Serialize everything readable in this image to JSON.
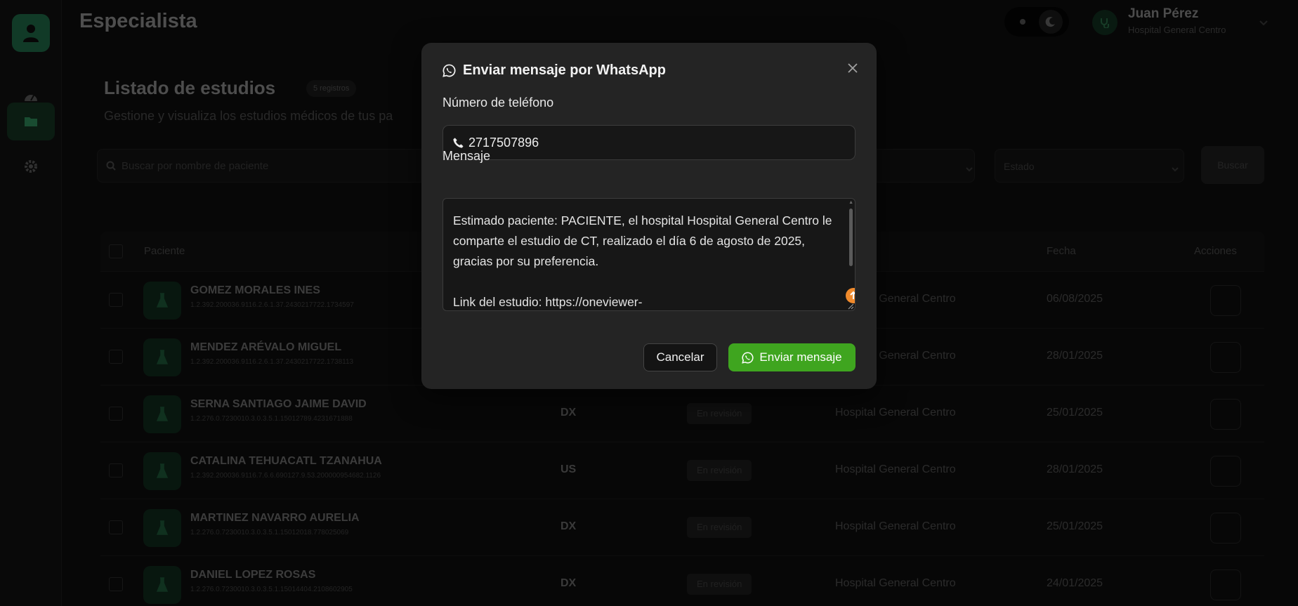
{
  "header": {
    "title": "Especialista",
    "user_name": "Juan Pérez",
    "user_hospital": "Hospital General Centro"
  },
  "sidebar": {
    "items": [
      {
        "icon": "dashboard-icon"
      },
      {
        "icon": "folder-icon",
        "active": true
      },
      {
        "icon": "gear-icon"
      }
    ]
  },
  "page": {
    "title": "Listado de estudios",
    "count_badge": "5 registros",
    "subtitle": "Gestione y visualiza los estudios médicos de tus pa",
    "search_placeholder": "Buscar por nombre de paciente",
    "estado_placeholder": "Estado",
    "buscar_label": "Buscar"
  },
  "table": {
    "headers": {
      "paciente": "Paciente",
      "fecha": "Fecha",
      "acciones": "Acciones"
    },
    "rows": [
      {
        "name": "GOMEZ MORALES INES",
        "uid": "1.2.392.200036.9116.2.6.1.37.2430217722.1734597",
        "modality": "",
        "status": "",
        "hospital": "Hospital General Centro",
        "date": "06/08/2025"
      },
      {
        "name": "MENDEZ ARÉVALO MIGUEL",
        "uid": "1.2.392.200036.9116.2.6.1.37.2430217722.1738113",
        "modality": "",
        "status": "",
        "hospital": "Hospital General Centro",
        "date": "28/01/2025"
      },
      {
        "name": "SERNA SANTIAGO JAIME DAVID",
        "uid": "1.2.276.0.7230010.3.0.3.5.1.15012789.4231671888",
        "modality": "DX",
        "status": "En revisión",
        "hospital": "Hospital General Centro",
        "date": "25/01/2025"
      },
      {
        "name": "CATALINA TEHUACATL TZANAHUA",
        "uid": "1.2.392.200036.9116.7.6.6.690127.9.53.200000954682.1126",
        "modality": "US",
        "status": "En revisión",
        "hospital": "Hospital General Centro",
        "date": "28/01/2025"
      },
      {
        "name": "MARTINEZ NAVARRO AURELIA",
        "uid": "1.2.276.0.7230010.3.0.3.5.1.15012018.778025069",
        "modality": "DX",
        "status": "En revisión",
        "hospital": "Hospital General Centro",
        "date": "25/01/2025"
      },
      {
        "name": "DANIEL LOPEZ ROSAS",
        "uid": "1.2.276.0.7230010.3.0.3.5.1.15014404.2108602905",
        "modality": "DX",
        "status": "En revisión",
        "hospital": "Hospital General Centro",
        "date": "24/01/2025"
      }
    ]
  },
  "modal": {
    "title": "Enviar mensaje por WhatsApp",
    "phone_label": "Número de teléfono",
    "phone_value": "2717507896",
    "message_label": "Mensaje",
    "message_text": "Estimado paciente: PACIENTE, el hospital Hospital General Centro le comparte el estudio de CT, realizado el día 6 de agosto de 2025, gracias por su preferencia.\n\nLink del estudio: https://oneviewer-",
    "cancel_label": "Cancelar",
    "send_label": "Enviar mensaje"
  },
  "colors": {
    "accent_green": "#3fa51f",
    "logo_green": "#1f6b47",
    "grammar_badge": "#f08a2c"
  }
}
